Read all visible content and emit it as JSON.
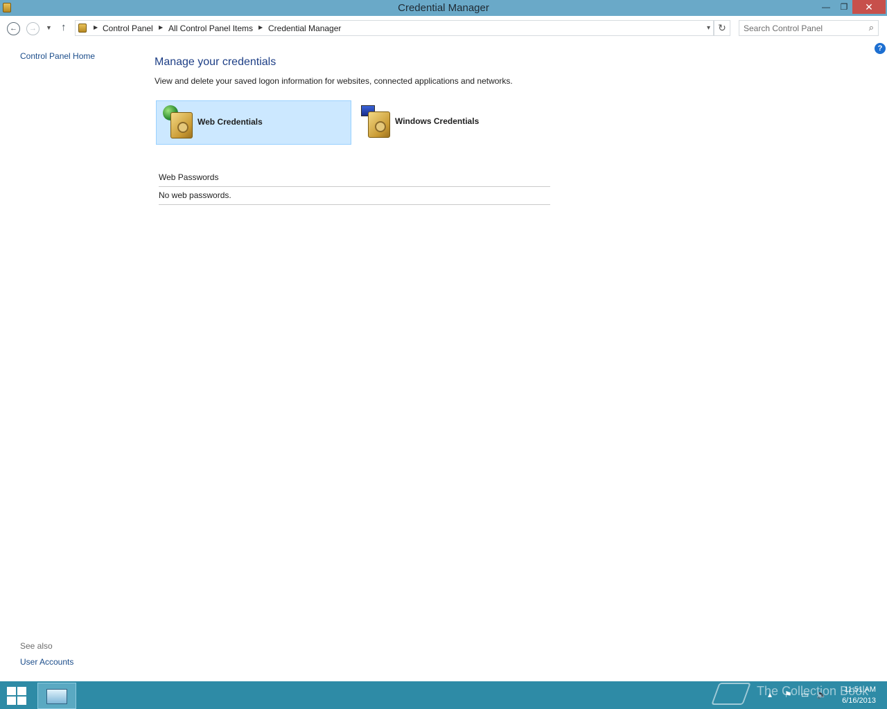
{
  "window": {
    "title": "Credential Manager",
    "minimize_glyph": "—",
    "maximize_glyph": "❐",
    "close_glyph": "✕"
  },
  "navigation": {
    "back_glyph": "←",
    "forward_glyph": "→",
    "recent_glyph": "▼",
    "up_glyph": "↑",
    "breadcrumb": [
      "Control Panel",
      "All Control Panel Items",
      "Credential Manager"
    ],
    "separator_glyph": "▶",
    "dropdown_glyph": "▾",
    "refresh_glyph": "↻",
    "search_placeholder": "Search Control Panel",
    "search_glyph": "⌕"
  },
  "left_pane": {
    "home_link": "Control Panel Home",
    "see_also": "See also",
    "user_accounts_link": "User Accounts"
  },
  "help_glyph": "?",
  "main": {
    "heading": "Manage your credentials",
    "description": "View and delete your saved logon information for websites, connected applications and networks.",
    "tiles": [
      {
        "label": "Web Credentials",
        "selected": true,
        "icon": "web-credentials-vault-icon"
      },
      {
        "label": "Windows Credentials",
        "selected": false,
        "icon": "windows-credentials-vault-icon"
      }
    ],
    "section_header": "Web Passwords",
    "empty_message": "No web passwords."
  },
  "taskbar": {
    "watermark": "The Collection Book",
    "time": "11:51 AM",
    "date": "6/16/2013",
    "tray_icons": [
      "show-hidden-icon",
      "action-center-flag-icon",
      "network-icon",
      "volume-icon"
    ],
    "tray_glyphs": [
      "▴",
      "⚑",
      "▭",
      "🔈"
    ]
  },
  "colors": {
    "title_bar": "#6aa9c8",
    "close_button": "#c7504b",
    "taskbar": "#2e8ba6",
    "link": "#1a4c8a",
    "heading": "#1e3f86",
    "selected_tile": "#cce8ff"
  }
}
